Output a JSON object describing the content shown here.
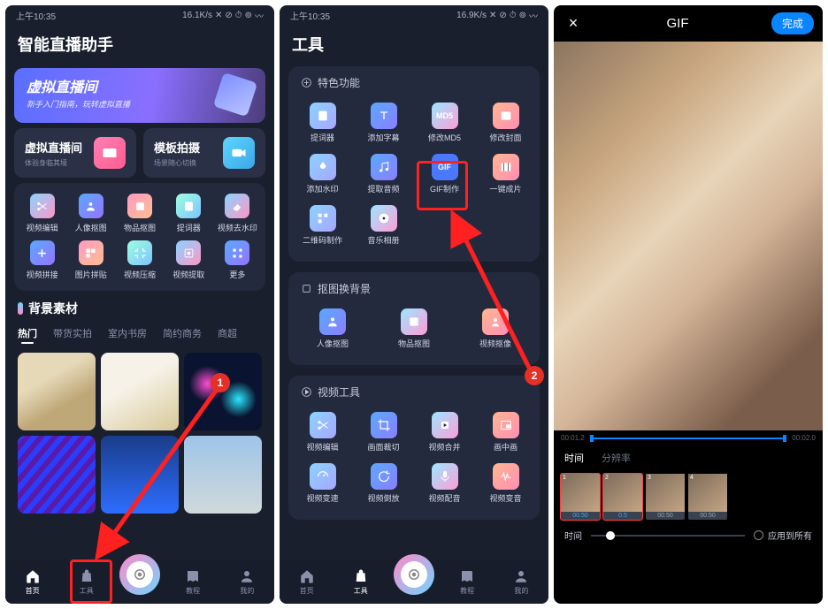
{
  "annotations": {
    "step1": "1",
    "step2": "2"
  },
  "screen1": {
    "statusbar": {
      "time": "上午10:35",
      "speed": "16.1K/s"
    },
    "header": "智能直播助手",
    "banner": {
      "title": "虚拟直播间",
      "subtitle": "新手入门指南，玩转虚拟直播"
    },
    "cards": [
      {
        "title": "虚拟直播间",
        "subtitle": "体验身临其境"
      },
      {
        "title": "模板拍摄",
        "subtitle": "场景随心切换"
      }
    ],
    "grid_row1": [
      "视频编辑",
      "人像抠图",
      "物品抠图",
      "提词器",
      "视频去水印"
    ],
    "grid_row2": [
      "视频拼接",
      "图片拼贴",
      "视频压缩",
      "视频提取",
      "更多"
    ],
    "bg_section_title": "背景素材",
    "bg_tabs": [
      "热门",
      "带货实拍",
      "室内书房",
      "简约商务",
      "商超"
    ],
    "bottomnav": [
      "首页",
      "工具",
      "",
      "教程",
      "我的"
    ]
  },
  "screen2": {
    "statusbar": {
      "time": "上午10:35",
      "speed": "16.9K/s"
    },
    "header": "工具",
    "section1": {
      "title": "特色功能",
      "items": [
        "提词器",
        "添加字幕",
        "修改MD5",
        "修改封面",
        "添加水印",
        "提取音频",
        "GIF制作",
        "一键成片",
        "二维码制作",
        "音乐相册"
      ]
    },
    "section2": {
      "title": "抠图换背景",
      "items": [
        "人像抠图",
        "物品抠图",
        "视频抠像"
      ]
    },
    "section3": {
      "title": "视频工具",
      "items": [
        "视频编辑",
        "画面裁切",
        "视频合并",
        "画中画",
        "视频变速",
        "视频倒放",
        "视频配音",
        "视频变音"
      ]
    },
    "bottomnav": [
      "首页",
      "工具",
      "",
      "教程",
      "我的"
    ]
  },
  "screen3": {
    "title": "GIF",
    "done": "完成",
    "time_start": "00:01.2",
    "time_end": "00:02.0",
    "tabs": [
      "时间",
      "分辨率"
    ],
    "frames": [
      {
        "num": "1",
        "dur": "00.50"
      },
      {
        "num": "2",
        "dur": "0.5"
      },
      {
        "num": "3",
        "dur": "00.50"
      },
      {
        "num": "4",
        "dur": "00.50"
      }
    ],
    "bottom_label": "时间",
    "apply_all": "应用到所有"
  }
}
